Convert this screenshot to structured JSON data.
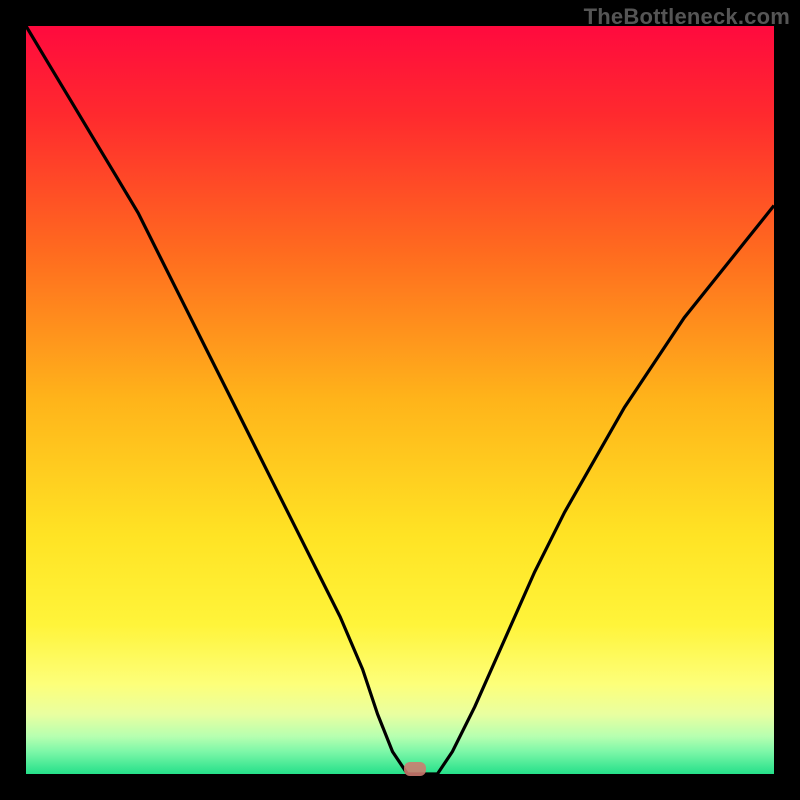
{
  "watermark": "TheBottleneck.com",
  "colors": {
    "frame": "#000000",
    "curve": "#000000",
    "marker": "#cf7a70",
    "gradient_stops": [
      {
        "pct": 0,
        "color": "#ff0a3e"
      },
      {
        "pct": 12,
        "color": "#ff2a2e"
      },
      {
        "pct": 30,
        "color": "#ff6a1f"
      },
      {
        "pct": 50,
        "color": "#ffb41a"
      },
      {
        "pct": 68,
        "color": "#ffe324"
      },
      {
        "pct": 80,
        "color": "#fff43a"
      },
      {
        "pct": 88,
        "color": "#fdff7a"
      },
      {
        "pct": 92,
        "color": "#e9ffa0"
      },
      {
        "pct": 95,
        "color": "#b6ffb0"
      },
      {
        "pct": 97,
        "color": "#7df7a8"
      },
      {
        "pct": 100,
        "color": "#25e08a"
      }
    ]
  },
  "chart_data": {
    "type": "line",
    "title": "",
    "xlabel": "",
    "ylabel": "",
    "xlim": [
      0,
      100
    ],
    "ylim": [
      0,
      100
    ],
    "grid": false,
    "legend": false,
    "series": [
      {
        "name": "bottleneck-curve",
        "x": [
          0,
          3,
          6,
          9,
          12,
          15,
          18,
          21,
          24,
          27,
          30,
          33,
          36,
          39,
          42,
          45,
          47,
          49,
          51,
          53,
          55,
          57,
          60,
          64,
          68,
          72,
          76,
          80,
          84,
          88,
          92,
          96,
          100
        ],
        "y": [
          100,
          95,
          90,
          85,
          80,
          75,
          69,
          63,
          57,
          51,
          45,
          39,
          33,
          27,
          21,
          14,
          8,
          3,
          0,
          0,
          0,
          3,
          9,
          18,
          27,
          35,
          42,
          49,
          55,
          61,
          66,
          71,
          76
        ]
      }
    ],
    "annotations": [
      {
        "name": "optimum-marker",
        "x": 52,
        "y": 0,
        "shape": "rounded-rect"
      }
    ]
  }
}
